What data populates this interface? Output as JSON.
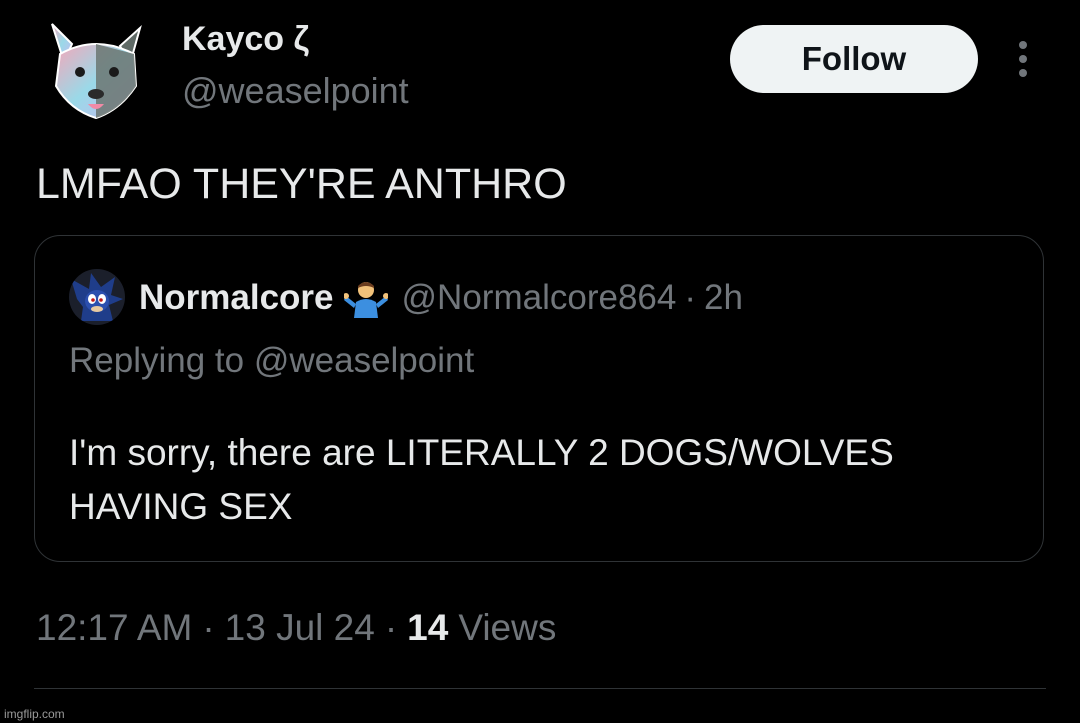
{
  "tweet": {
    "display_name": "Kayco ζ",
    "handle": "@weaselpoint",
    "follow_label": "Follow",
    "text": "LMFAO THEY'RE ANTHRO",
    "time": "12:17 AM",
    "date": "13 Jul 24",
    "separator": "·",
    "views_count": "14",
    "views_label": "Views"
  },
  "quote": {
    "display_name": "Normalcore",
    "handle": "@Normalcore864",
    "separator": "·",
    "time": "2h",
    "replying_to": "Replying to @weaselpoint",
    "body": "I'm sorry, there are LITERALLY 2 DOGS/WOLVES HAVING SEX"
  },
  "watermark": "imgflip.com",
  "icons": {
    "avatar": "furry-avatar",
    "quote_avatar": "sonic-avatar",
    "emoji": "person-shrugging-emoji",
    "more": "more-vertical-icon"
  },
  "colors": {
    "background": "#000000",
    "primary_text": "#e7e9ea",
    "secondary_text": "#71767b",
    "follow_bg": "#eff3f4",
    "border": "#2f3336"
  }
}
